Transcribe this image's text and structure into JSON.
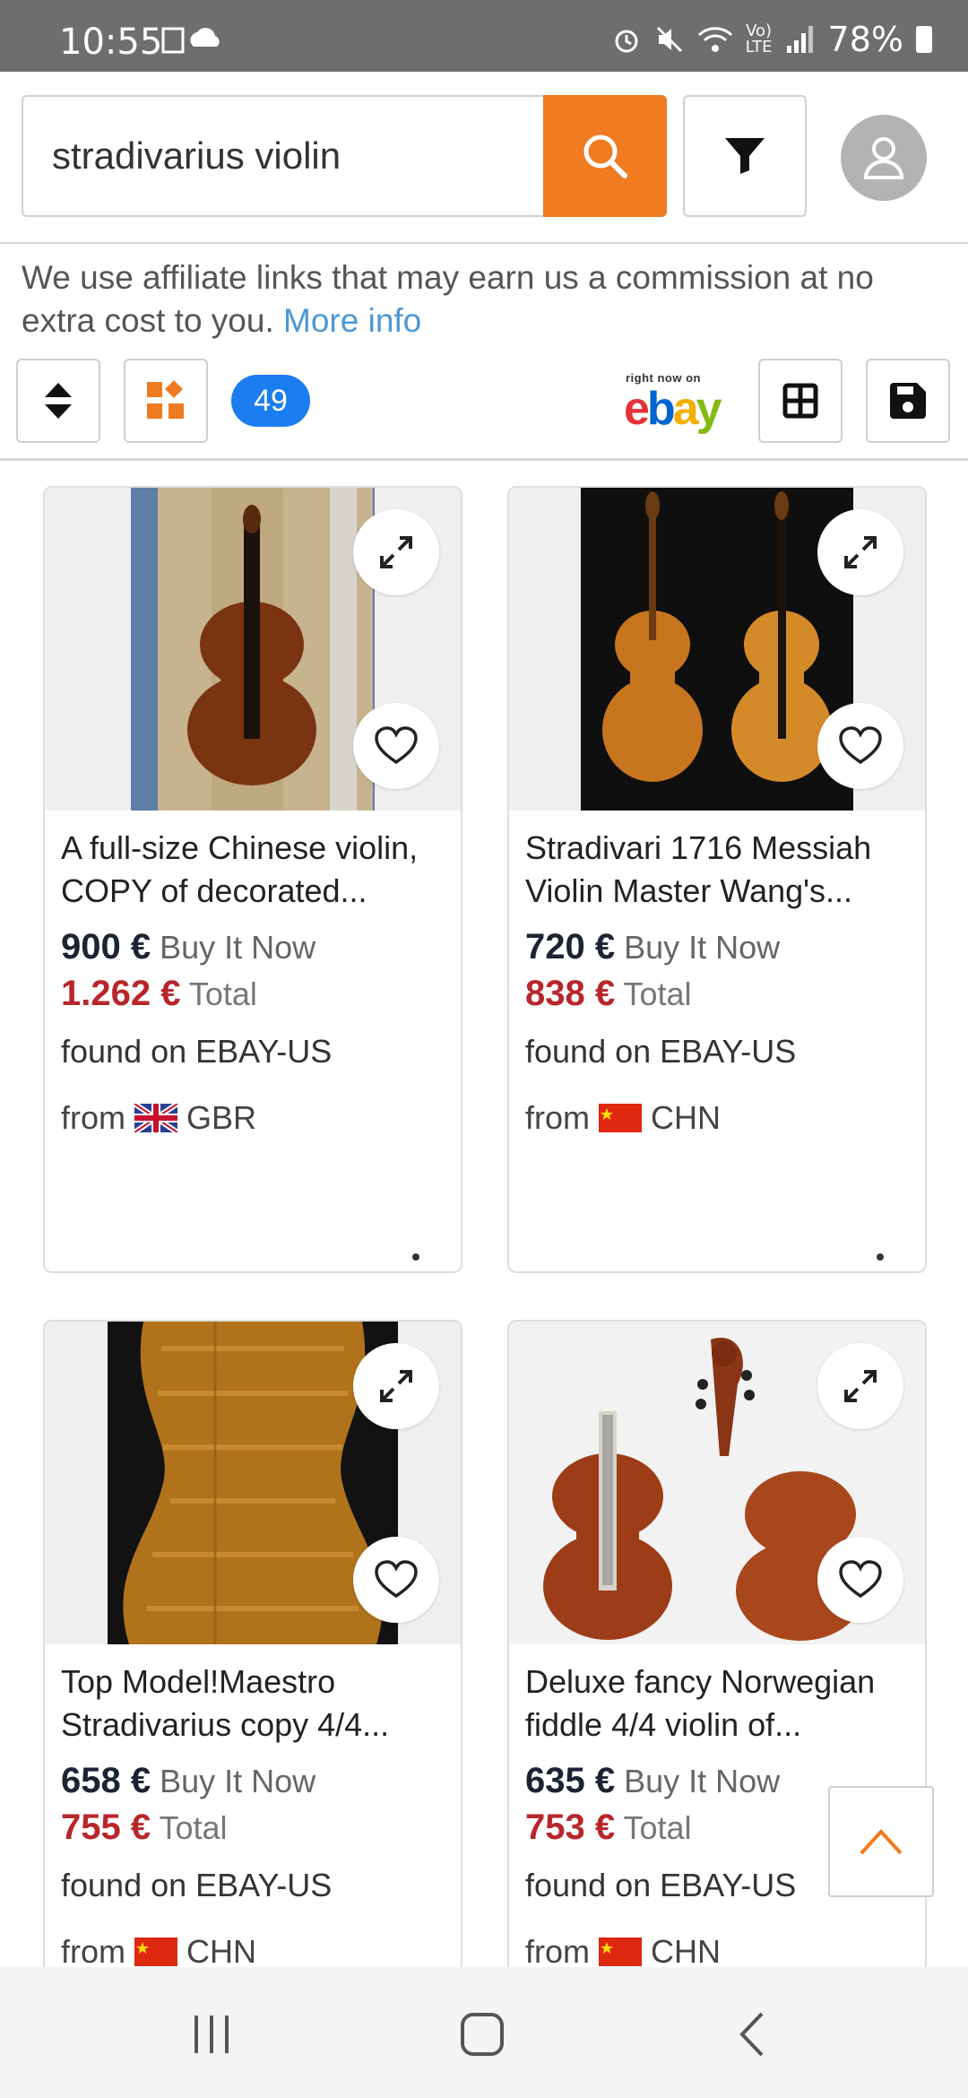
{
  "status_bar": {
    "time": "10:55",
    "battery": "78%"
  },
  "search": {
    "query": "stradivarius violin"
  },
  "notice": {
    "text": "We use affiliate links that may earn us a commission at no extra cost to you.",
    "link": "More info"
  },
  "toolbar": {
    "result_count": "49",
    "ebay_tagline": "right now on",
    "ebay_letters": [
      "e",
      "b",
      "a",
      "y"
    ]
  },
  "colors": {
    "accent": "#f07b20",
    "badge_blue": "#1c7df0",
    "total_red": "#b8262c",
    "link_blue": "#4a98d6"
  },
  "results": [
    {
      "title": "A full-size Chinese violin, COPY of decorated...",
      "price": "900 €",
      "price_label": "Buy It Now",
      "total": "1.262 €",
      "total_label": "Total",
      "found": "found on EBAY-US",
      "from_label": "from",
      "country": "GBR"
    },
    {
      "title": "Stradivari 1716 Messiah Violin Master Wang's...",
      "price": "720 €",
      "price_label": "Buy It Now",
      "total": "838 €",
      "total_label": "Total",
      "found": "found on EBAY-US",
      "from_label": "from",
      "country": "CHN"
    },
    {
      "title": "Top Model!Maestro Stradivarius copy 4/4...",
      "price": "658 €",
      "price_label": "Buy It Now",
      "total": "755 €",
      "total_label": "Total",
      "found": "found on EBAY-US",
      "from_label": "from",
      "country": "CHN"
    },
    {
      "title": "Deluxe fancy Norwegian fiddle 4/4 violin of...",
      "price": "635 €",
      "price_label": "Buy It Now",
      "total": "753 €",
      "total_label": "Total",
      "found": "found on EBAY-US",
      "from_label": "from",
      "country": "CHN"
    }
  ]
}
